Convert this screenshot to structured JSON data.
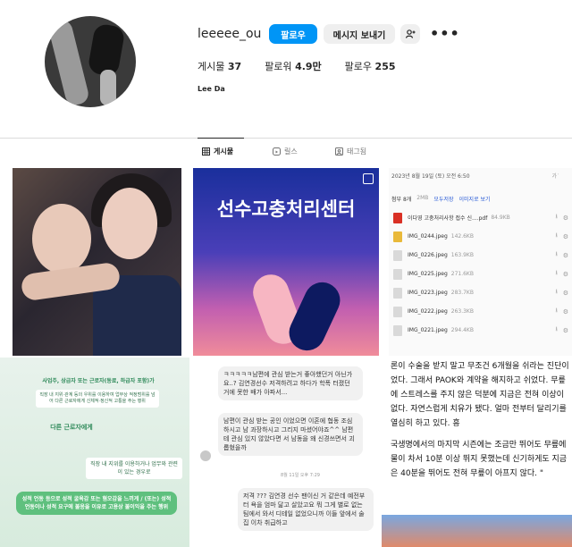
{
  "profile": {
    "username": "leeeee_ou",
    "follow_label": "팔로우",
    "message_label": "메시지 보내기",
    "add_friend_icon": "person-add-icon",
    "more_label": "•••",
    "stats": [
      {
        "label": "게시물",
        "value": "37"
      },
      {
        "label": "팔로워",
        "value": "4.9만"
      },
      {
        "label": "팔로우",
        "value": "255"
      }
    ],
    "full_name": "Lee Da"
  },
  "tabs": [
    {
      "label": "게시물",
      "icon": "grid-icon"
    },
    {
      "label": "릴스",
      "icon": "reels-icon"
    },
    {
      "label": "태그됨",
      "icon": "tag-icon"
    }
  ],
  "posts": {
    "post2_title": "선수고충처리센터",
    "post3": {
      "date": "2023년 8월 19일 (토) 오전 6:50",
      "font_size_label": "가˙",
      "attach_label": "첨부 8개",
      "attach_size": "2MB",
      "save_all": "모두저장",
      "preview": "이미지로 보기",
      "files": [
        {
          "name": "이다영 고충처리사항 접수 신....pdf",
          "size": "84.9KB",
          "color": "#d93025"
        },
        {
          "name": "IMG_0244.jpeg",
          "size": "142.6KB",
          "color": "#e9b93a"
        },
        {
          "name": "IMG_0226.jpeg",
          "size": "163.9KB",
          "color": "#d9d9d9"
        },
        {
          "name": "IMG_0225.jpeg",
          "size": "271.6KB",
          "color": "#d9d9d9"
        },
        {
          "name": "IMG_0223.jpeg",
          "size": "283.7KB",
          "color": "#d9d9d9"
        },
        {
          "name": "IMG_0222.jpeg",
          "size": "263.3KB",
          "color": "#d9d9d9"
        },
        {
          "name": "IMG_0221.jpeg",
          "size": "294.4KB",
          "color": "#d9d9d9"
        }
      ]
    },
    "post4": {
      "box1": "사업주, 상급자 또는 근로자(동료, 하급자 포함)가",
      "box2": "직장 내 지위·관계 등의 우위를 이용하여 업무상 적정범위를 넘어 다른 근로자에게 신체적·정신적 고통을 주는 행위",
      "box3": "다른 근로자에게",
      "box4": "직장 내 지위를 이용하거나 업무와 관련이 있는 경우로",
      "box5": "성적 언동 등으로 성적 굴욕감 또는 혐오감을 느끼게 / (또는) 성적 언동이나 성적 요구에 불응을 이유로 고용상 불이익을 주는 행위"
    },
    "post5": {
      "bubble1": "ㅋㅋㅋㅋㅋ남편에 관심 받는거 좋아했던거 아닌가요..? 김연경선수 저격하려고 하다가 학폭 터졌던 거에 못한 배가 아파서...",
      "bubble2": "남편이 관심 받는 공인 이었으면 이혼에 협동 조심하시고 남 과장하시고 그리지 마셨어야죠^^ 남편테 관심 있지 않았다면 서 남동을 왜 신경쓰면서 괴롭혔을까",
      "time": "8월 11일 오후 7:29",
      "bubble3": "저격 ??? 김연경 선수 팬이신 거 같은데 예전부터 욕을 엄마 닮고 살았고요 뭐 그게 별로 없는 팀에서 와서 디테일 없었으니까 이들 앞에서 술집 이차 취급하고"
    },
    "post6": {
      "para1": "론이 수술을 받지 말고 무조건 6개월을 쉬라는 진단이었다. 그래서 PAOK와 계약을 해지하고 쉬었다. 무릎에 스트레스를 주지 않은 덕분에 지금은 전혀 이상이 없다. 자연스럽게 치유가 됐다. 얼마 전부터 달리기를 열심히 하고 있다. 흥",
      "para2": "국생명에서의 마지막 시즌에는 조금만 뛰어도 무릎에 물이 차서 10분 이상 뛰지 못했는데 신기하게도 지금은 40분을 뛰어도 전혀 무릎이 아프지 않다. \""
    }
  }
}
